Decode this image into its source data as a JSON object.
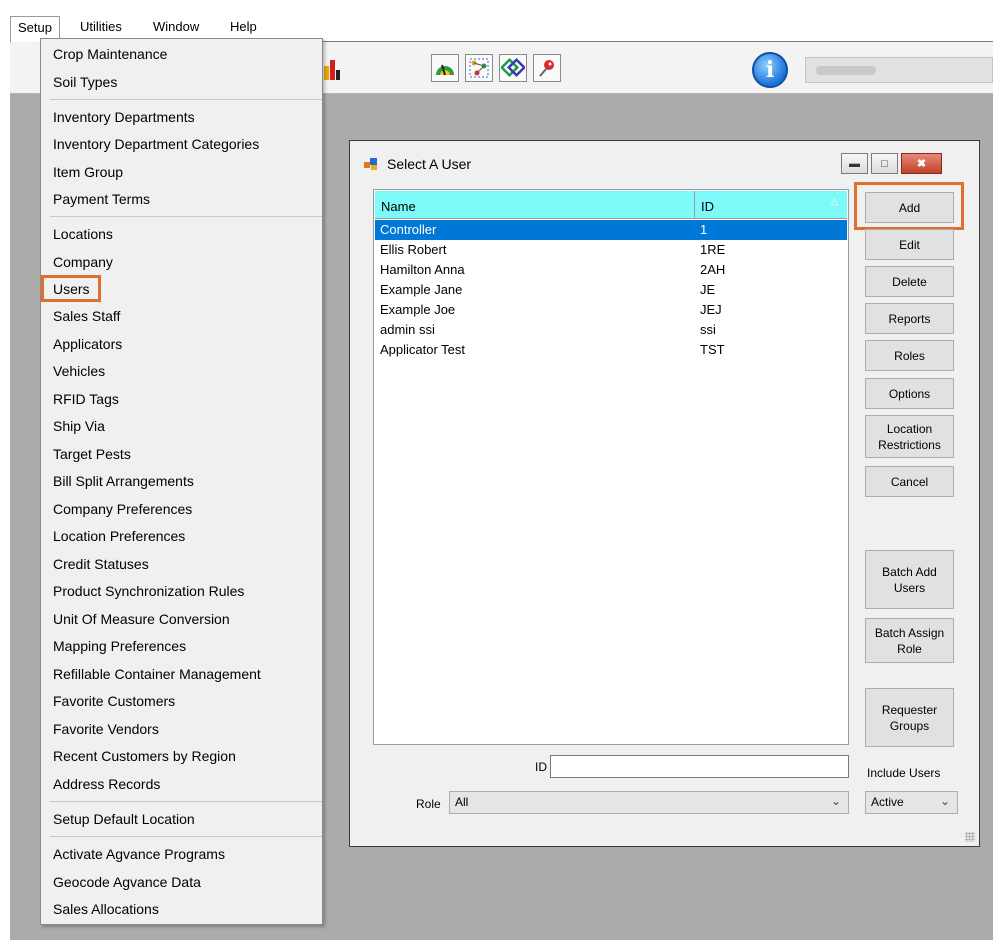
{
  "menubar": {
    "items": [
      "Setup",
      "Utilities",
      "Window",
      "Help"
    ]
  },
  "toolbar": {
    "info_icon_glyph": "i"
  },
  "setup_menu": {
    "items": [
      "Crop Maintenance",
      "Soil Types",
      "Inventory Departments",
      "Inventory Department Categories",
      "Item Group",
      "Payment Terms",
      "Locations",
      "Company",
      "Users",
      "Sales Staff",
      "Applicators",
      "Vehicles",
      "RFID Tags",
      "Ship Via",
      "Target Pests",
      "Bill Split Arrangements",
      "Company Preferences",
      "Location Preferences",
      "Credit Statuses",
      "Product Synchronization Rules",
      "Unit Of Measure Conversion",
      "Mapping Preferences",
      "Refillable Container Management",
      "Favorite Customers",
      "Favorite Vendors",
      "Recent Customers by Region",
      "Address Records",
      "Setup Default Location",
      "Activate Agvance Programs",
      "Geocode Agvance Data",
      "Sales Allocations"
    ]
  },
  "dialog": {
    "title": "Select A User",
    "columns": {
      "name": "Name",
      "id": "ID"
    },
    "rows": [
      {
        "name": "Controller",
        "id": "1"
      },
      {
        "name": "Ellis Robert",
        "id": "1RE"
      },
      {
        "name": "Hamilton Anna",
        "id": "2AH"
      },
      {
        "name": "Example Jane",
        "id": "JE"
      },
      {
        "name": "Example Joe",
        "id": "JEJ"
      },
      {
        "name": "admin ssi",
        "id": "ssi"
      },
      {
        "name": "Applicator Test",
        "id": "TST"
      }
    ],
    "buttons": {
      "add": "Add",
      "edit": "Edit",
      "delete": "Delete",
      "reports": "Reports",
      "roles": "Roles",
      "options": "Options",
      "location_restrictions": "Location Restrictions",
      "cancel": "Cancel",
      "batch_add_users": "Batch Add Users",
      "batch_assign_role": "Batch Assign Role",
      "requester_groups": "Requester Groups"
    },
    "id_label": "ID",
    "id_value": "",
    "role_label": "Role",
    "role_value": "All",
    "include_users_label": "Include Users",
    "include_users_value": "Active"
  },
  "colors": {
    "highlight": "#e06e2c",
    "header_bg": "#7dfaf9",
    "selection": "#0078d7",
    "workspace": "#ababab"
  }
}
